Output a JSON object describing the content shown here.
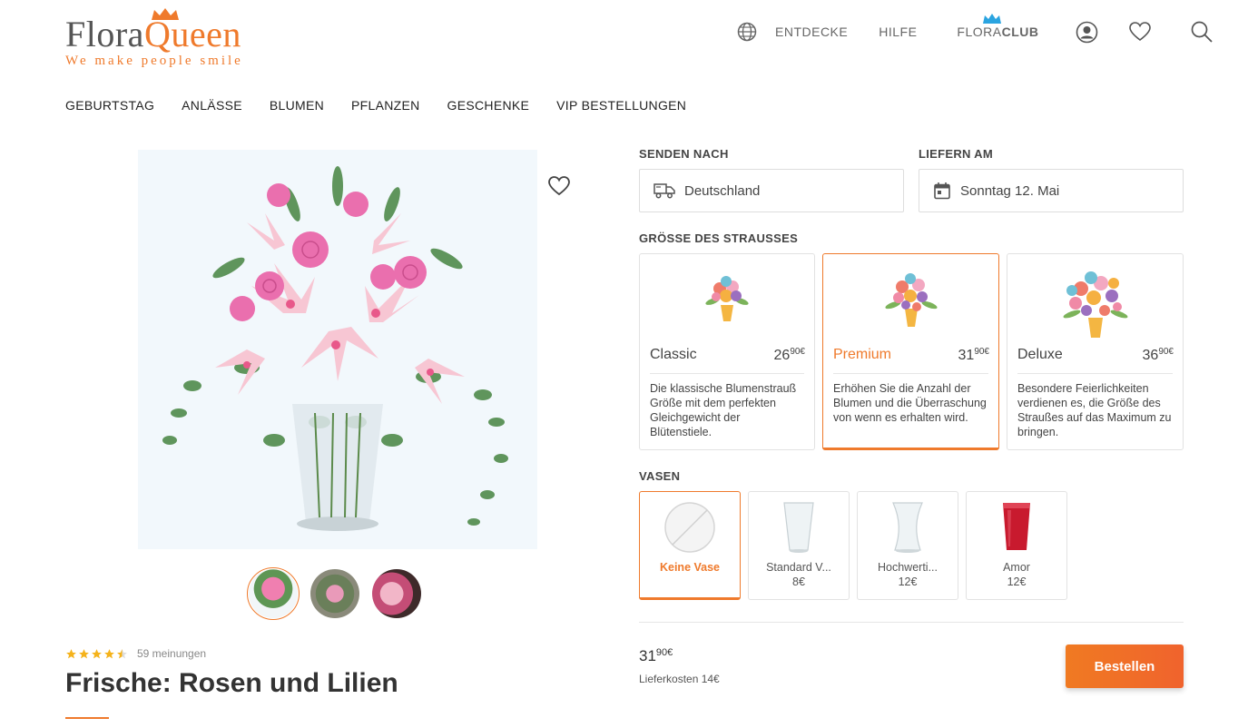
{
  "logo": {
    "brand_part1": "Flora",
    "brand_part2": "Queen",
    "tagline": "We make people smile"
  },
  "topnav": {
    "discover": "ENTDECKE",
    "help": "HILFE",
    "club_part1": "FLORA",
    "club_part2": "CLUB"
  },
  "mainnav": [
    "GEBURTSTAG",
    "ANLÄSSE",
    "BLUMEN",
    "PFLANZEN",
    "GESCHENKE",
    "VIP BESTELLUNGEN"
  ],
  "product": {
    "title": "Frische: Rosen und Lilien",
    "rating": 4.5,
    "reviews": "59 meinungen"
  },
  "send_to": {
    "label": "SENDEN NACH",
    "value": "Deutschland"
  },
  "deliver_on": {
    "label": "LIEFERN AM",
    "value": "Sonntag 12. Mai"
  },
  "size": {
    "label": "GRÖSSE DES STRAUSSES",
    "options": [
      {
        "name": "Classic",
        "price_main": "26",
        "price_sup": "90€",
        "desc": "Die klassische Blumenstrauß Größe mit dem perfekten Gleichgewicht der Blütenstiele."
      },
      {
        "name": "Premium",
        "price_main": "31",
        "price_sup": "90€",
        "desc": "Erhöhen Sie die Anzahl der Blumen und die Überraschung von wenn es erhalten wird."
      },
      {
        "name": "Deluxe",
        "price_main": "36",
        "price_sup": "90€",
        "desc": "Besondere Feierlichkeiten verdienen es, die Größe des Straußes auf das Maximum zu bringen."
      }
    ],
    "selected": "Premium"
  },
  "vases": {
    "label": "VASEN",
    "options": [
      {
        "name": "Keine Vase",
        "price": ""
      },
      {
        "name": "Standard V...",
        "price": "8€"
      },
      {
        "name": "Hochwerti...",
        "price": "12€"
      },
      {
        "name": "Amor",
        "price": "12€"
      }
    ],
    "selected": "Keine Vase"
  },
  "summary": {
    "total_main": "31",
    "total_sup": "90€",
    "delivery": "Lieferkosten 14€",
    "order_button": "Bestellen"
  },
  "colors": {
    "accent": "#ef7a2c",
    "star": "#f5b31b"
  }
}
